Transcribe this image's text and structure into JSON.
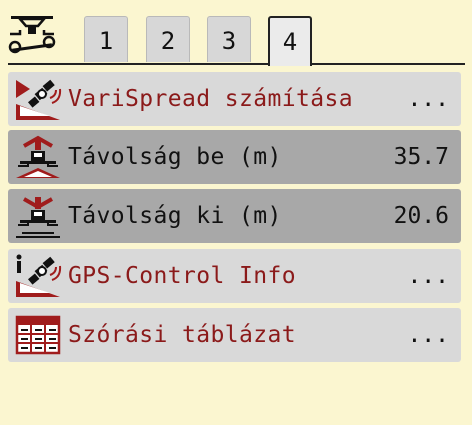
{
  "header": {
    "icon": "spreader-settings-icon",
    "tabs": [
      {
        "label": "1",
        "active": false
      },
      {
        "label": "2",
        "active": false
      },
      {
        "label": "3",
        "active": false
      },
      {
        "label": "4",
        "active": true
      }
    ]
  },
  "menu": {
    "items": [
      {
        "label": "VariSpread számítása",
        "right": "...",
        "icon": "variSpread-icon"
      },
      {
        "label": "Távolság be (m)",
        "right": "35.7",
        "icon": "distance-on-icon"
      },
      {
        "label": "Távolság ki (m)",
        "right": "20.6",
        "icon": "distance-off-icon"
      },
      {
        "label": "GPS-Control Info",
        "right": "...",
        "icon": "gps-info-icon"
      },
      {
        "label": "Szórási táblázat",
        "right": "...",
        "icon": "spread-table-icon"
      }
    ]
  },
  "colors": {
    "background": "#fbf6d0",
    "accent": "#8b1a1a",
    "row_link": "#d9d9d9",
    "row_value": "#a8a8a8"
  }
}
